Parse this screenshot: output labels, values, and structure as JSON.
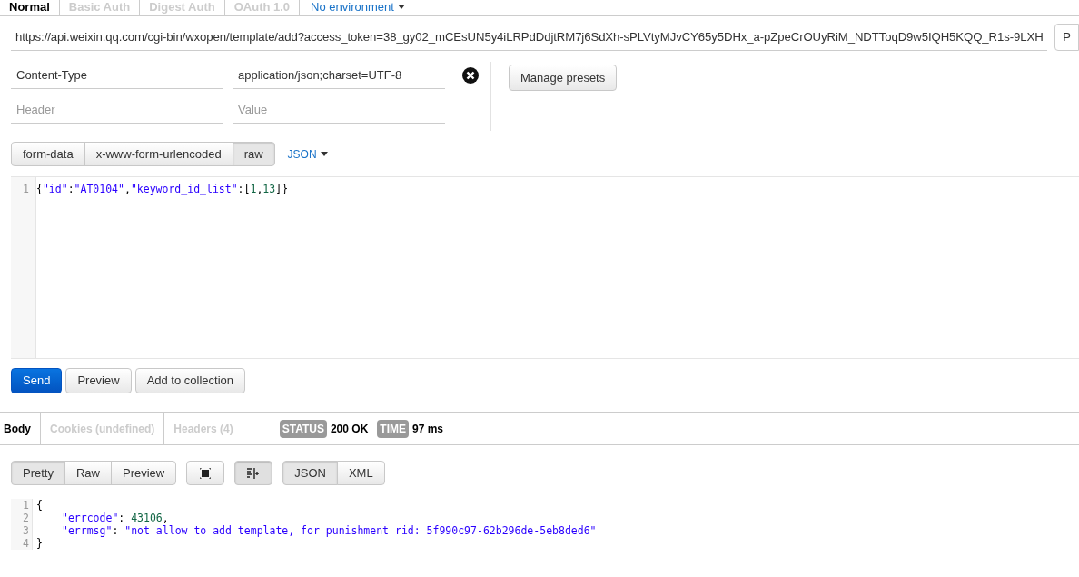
{
  "auth_tabs": [
    {
      "label": "Normal",
      "selected": true
    },
    {
      "label": "Basic Auth",
      "selected": false
    },
    {
      "label": "Digest Auth",
      "selected": false
    },
    {
      "label": "OAuth 1.0",
      "selected": false
    }
  ],
  "environment": {
    "label": "No environment"
  },
  "url": {
    "value": "https://api.weixin.qq.com/cgi-bin/wxopen/template/add?access_token=38_gy02_mCEsUN5y4iLRPdDdjtRM7j6SdXh-sPLVtyMJvCY65y5DHx_a-pZpeCrOUyRiM_NDTToqD9w5IQH5KQQ_R1s-9LXH"
  },
  "url_side_button": {
    "label": "P"
  },
  "headers": [
    {
      "key": "Content-Type",
      "value": "application/json;charset=UTF-8"
    },
    {
      "key_placeholder": "Header",
      "value_placeholder": "Value"
    }
  ],
  "manage_presets": "Manage presets",
  "body_modes": [
    {
      "label": "form-data",
      "selected": false
    },
    {
      "label": "x-www-form-urlencoded",
      "selected": false
    },
    {
      "label": "raw",
      "selected": true
    }
  ],
  "raw_type": "JSON",
  "request_body": {
    "lines": [
      {
        "number": "1",
        "tokens": [
          {
            "kind": "punct",
            "text": "{"
          },
          {
            "kind": "string",
            "text": "\"id\""
          },
          {
            "kind": "punct",
            "text": ":"
          },
          {
            "kind": "string",
            "text": "\"AT0104\""
          },
          {
            "kind": "punct",
            "text": ","
          },
          {
            "kind": "string",
            "text": "\"keyword_id_list\""
          },
          {
            "kind": "punct",
            "text": ":["
          },
          {
            "kind": "number",
            "text": "1"
          },
          {
            "kind": "punct",
            "text": ","
          },
          {
            "kind": "number",
            "text": "13"
          },
          {
            "kind": "punct",
            "text": "]}"
          }
        ]
      }
    ]
  },
  "actions": [
    {
      "label": "Send",
      "kind": "primary"
    },
    {
      "label": "Preview",
      "kind": "default"
    },
    {
      "label": "Add to collection",
      "kind": "default"
    }
  ],
  "response_tabs": [
    {
      "label": "Body",
      "selected": true
    },
    {
      "label": "Cookies (undefined)",
      "selected": false
    },
    {
      "label": "Headers (4)",
      "selected": false
    }
  ],
  "status": {
    "badge": "STATUS",
    "value": "200 OK"
  },
  "time": {
    "badge": "TIME",
    "value": "97 ms"
  },
  "view_modes": [
    {
      "label": "Pretty",
      "selected": true
    },
    {
      "label": "Raw",
      "selected": false
    },
    {
      "label": "Preview",
      "selected": false
    }
  ],
  "wrap_toggle": {
    "on": true
  },
  "formats": [
    {
      "label": "JSON",
      "selected": true
    },
    {
      "label": "XML",
      "selected": false
    }
  ],
  "response_body": {
    "lines": [
      {
        "number": "1",
        "tokens": [
          {
            "kind": "punct",
            "text": "{"
          }
        ]
      },
      {
        "number": "2",
        "indented": true,
        "tokens": [
          {
            "kind": "key",
            "text": "\"errcode\""
          },
          {
            "kind": "punct",
            "text": ": "
          },
          {
            "kind": "number",
            "text": "43106"
          },
          {
            "kind": "punct",
            "text": ","
          }
        ]
      },
      {
        "number": "3",
        "indented": true,
        "tokens": [
          {
            "kind": "key",
            "text": "\"errmsg\""
          },
          {
            "kind": "punct",
            "text": ": "
          },
          {
            "kind": "string",
            "text": "\"not allow to add template, for punishment rid: 5f990c97-62b296de-5eb8ded6\""
          }
        ]
      },
      {
        "number": "4",
        "tokens": [
          {
            "kind": "punct",
            "text": "}"
          }
        ]
      }
    ]
  }
}
